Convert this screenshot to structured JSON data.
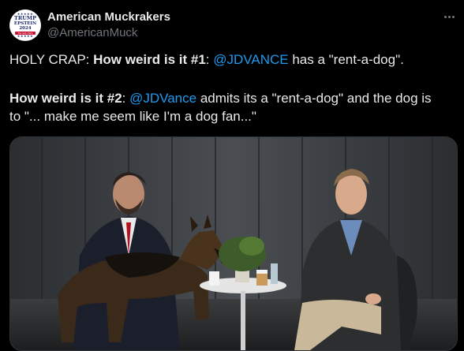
{
  "author": {
    "name": "American Muckrakers",
    "handle": "@AmericanMuck",
    "avatar": {
      "line1": "TRUMP",
      "line2": "EPSTEIN",
      "line3": "2024",
      "band": "The Sick Party"
    }
  },
  "post": {
    "line1": {
      "lead": "HOLY CRAP:  ",
      "bold": "How weird is it #1",
      "sep": ":  ",
      "mention": "@JDVANCE",
      "rest": " has a \"rent-a-dog\"."
    },
    "line2": {
      "bold": "How weird is it #2",
      "sep": ":  ",
      "mention": "@JDVance",
      "rest": " admits its a \"rent-a-dog\" and the dog is"
    },
    "line3": {
      "text": "to \"... make me seem like I'm a dog fan...\""
    }
  },
  "media": {
    "icon": "video-thumbnail"
  },
  "colors": {
    "background": "#000000",
    "text": "#e7e9ea",
    "muted": "#71767b",
    "link": "#1d9bf0"
  }
}
